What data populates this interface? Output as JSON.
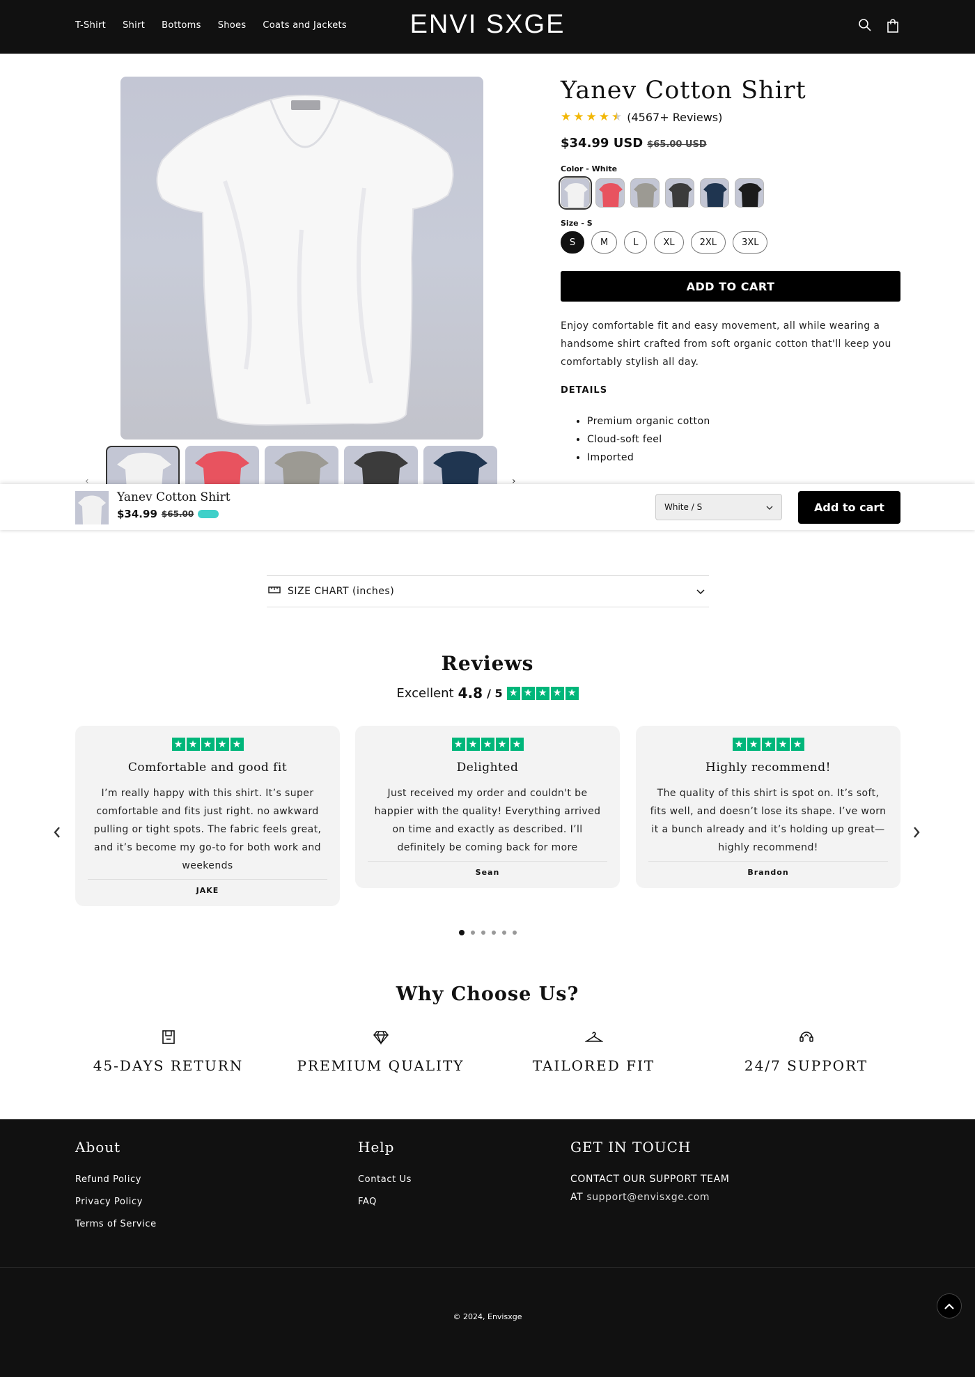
{
  "header": {
    "nav": [
      "T-Shirt",
      "Shirt",
      "Bottoms",
      "Shoes",
      "Coats and Jackets"
    ],
    "logo": "ENVI SXGE",
    "icons": [
      "search-icon",
      "cart-icon"
    ]
  },
  "product": {
    "title": "Yanev Cotton Shirt",
    "rating": 4.5,
    "reviews_text": "(4567+ Reviews)",
    "price": "$34.99 USD",
    "compare_price": "$65.00 USD",
    "color_label": "Color - White",
    "colors": [
      "#f2f2f2",
      "#e8535f",
      "#9c9a93",
      "#3b3b3b",
      "#1f3550",
      "#1b1b1b"
    ],
    "size_label": "Size - S",
    "sizes": [
      "S",
      "M",
      "L",
      "XL",
      "2XL",
      "3XL"
    ],
    "add_to_cart": "ADD TO CART",
    "description": "Enjoy comfortable fit and easy movement, all while wearing a handsome shirt crafted from soft organic cotton that'll keep you comfortably stylish all day.",
    "details_title": "DETAILS",
    "details": [
      "Premium organic cotton",
      "Cloud-soft feel",
      "Imported"
    ],
    "thumb_colors": [
      "#f2f2f2",
      "#e8535f",
      "#9c9a93",
      "#3b3b3b",
      "#1f3550"
    ]
  },
  "sticky": {
    "name": "Yanev Cotton Shirt",
    "price": "$34.99",
    "compare_price": "$65.00",
    "variant": "White / S",
    "button": "Add to cart"
  },
  "size_chart": {
    "label": "SIZE CHART (inches)"
  },
  "reviews": {
    "title": "Reviews",
    "excellent_label": "Excellent",
    "score": "4.8",
    "out_of": "/ 5",
    "cards": [
      {
        "title": "Comfortable and good fit",
        "text": "I’m really happy with this shirt. It’s super comfortable and fits just right. no awkward pulling or tight spots. The fabric feels great, and it’s become my go-to for both work and weekends",
        "author": "JAKE"
      },
      {
        "title": "Delighted",
        "text": "Just received my order and couldn't be happier with the quality! Everything arrived on time and exactly as described. I’ll definitely be coming back for more",
        "author": "Sean"
      },
      {
        "title": "Highly recommend!",
        "text": "The quality of this shirt is spot on. It’s soft, fits well, and doesn’t lose its shape. I’ve worn it a bunch already and it’s holding up great—highly recommend!",
        "author": "Brandon"
      }
    ],
    "dots": 6,
    "active_dot": 0
  },
  "why": {
    "title": "Why Choose Us?",
    "features": [
      {
        "icon": "return-box-icon",
        "label": "45-DAYS RETURN"
      },
      {
        "icon": "diamond-icon",
        "label": "PREMIUM QUALITY"
      },
      {
        "icon": "hanger-icon",
        "label": "TAILORED FIT"
      },
      {
        "icon": "support-headset-icon",
        "label": "24/7 SUPPORT"
      }
    ]
  },
  "footer": {
    "about_title": "About",
    "about_links": [
      "Refund Policy",
      "Privacy Policy",
      "Terms of Service"
    ],
    "help_title": "Help",
    "help_links": [
      "Contact Us",
      "FAQ"
    ],
    "contact_title": "GET IN TOUCH",
    "contact_line1": "CONTACT OUR SUPPORT TEAM",
    "contact_at": "AT",
    "contact_email": "support@envisxge.com",
    "copyright": "© 2024, Envisxge"
  }
}
